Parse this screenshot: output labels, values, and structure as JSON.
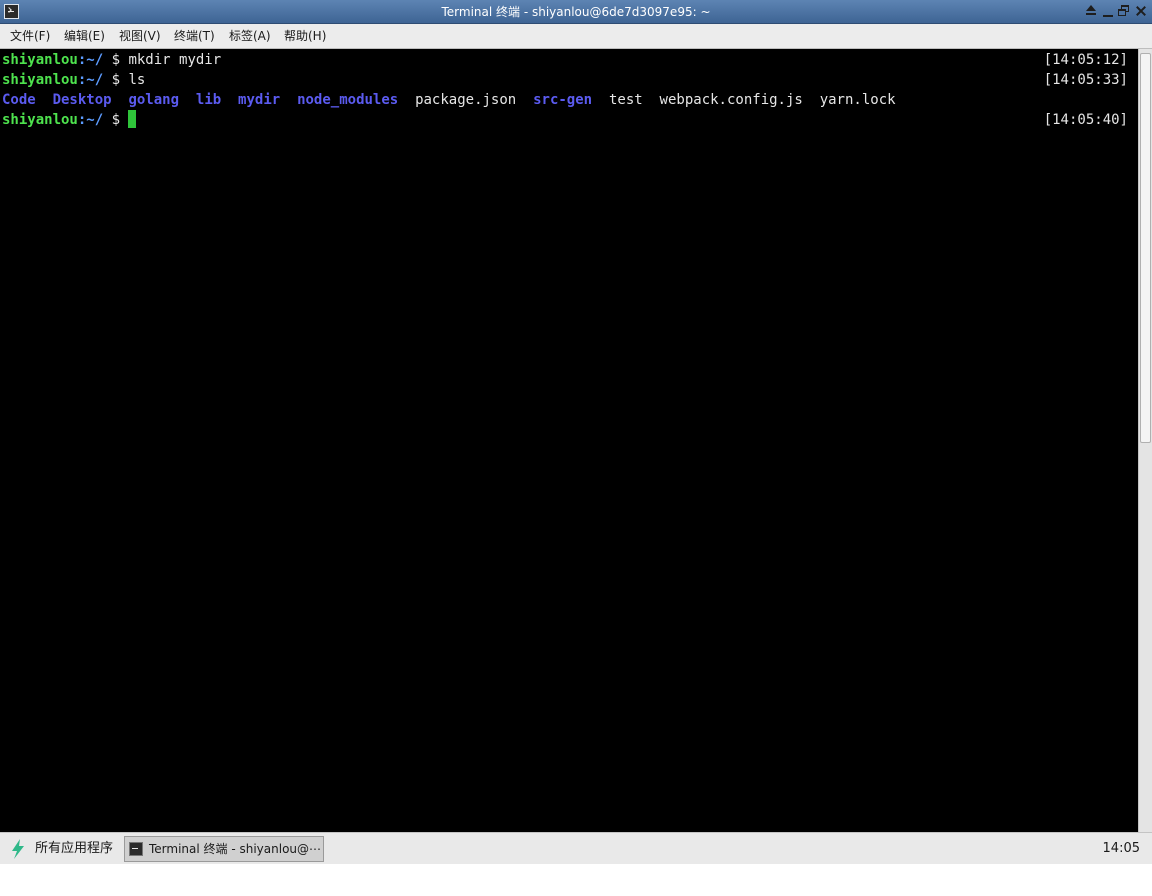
{
  "window": {
    "title": "Terminal 终端 - shiyanlou@6de7d3097e95: ~",
    "icon": "terminal-icon"
  },
  "menu": [
    {
      "label": "文件(F)"
    },
    {
      "label": "编辑(E)"
    },
    {
      "label": "视图(V)"
    },
    {
      "label": "终端(T)"
    },
    {
      "label": "标签(A)"
    },
    {
      "label": "帮助(H)"
    }
  ],
  "terminal": {
    "user": "shiyanlou",
    "path": ":~/",
    "prompt": " $ ",
    "lines": [
      {
        "command": "mkdir mydir",
        "time": "[14:05:12]"
      },
      {
        "command": "ls",
        "time": "[14:05:33]"
      },
      {
        "command": "",
        "time": "[14:05:40]"
      }
    ],
    "ls_output": [
      {
        "name": "Code",
        "kind": "dir"
      },
      {
        "name": "Desktop",
        "kind": "dir"
      },
      {
        "name": "golang",
        "kind": "dir"
      },
      {
        "name": "lib",
        "kind": "dir"
      },
      {
        "name": "mydir",
        "kind": "dir"
      },
      {
        "name": "node_modules",
        "kind": "dir"
      },
      {
        "name": "package.json",
        "kind": "file"
      },
      {
        "name": "src-gen",
        "kind": "dir"
      },
      {
        "name": "test",
        "kind": "file"
      },
      {
        "name": "webpack.config.js",
        "kind": "file"
      },
      {
        "name": "yarn.lock",
        "kind": "file"
      }
    ],
    "colors": {
      "prompt_user": "#4ee34e",
      "prompt_path": "#5c9cff",
      "directory": "#5b5bf0",
      "cursor": "#2fc43a"
    }
  },
  "taskbar": {
    "apps_label": "所有应用程序",
    "task_label": "Terminal 终端 - shiyanlou@⋯",
    "clock": "14:05"
  }
}
